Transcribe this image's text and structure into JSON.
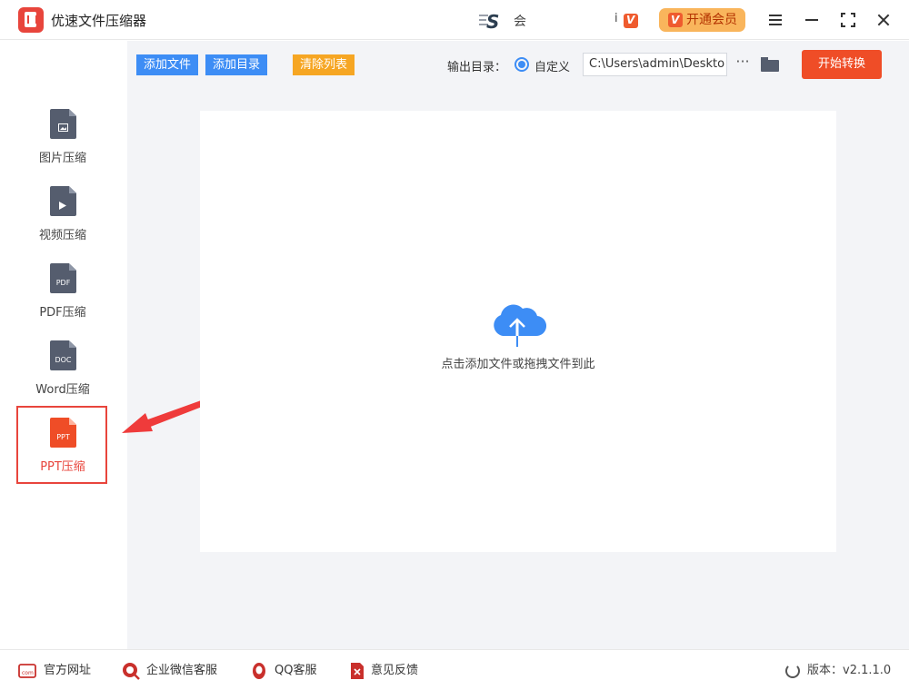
{
  "app": {
    "title": "优速文件压缩器",
    "notice_text": "会",
    "vip_mini_text": "i",
    "vip_button": "开通会员",
    "colors": {
      "accent": "#3d8df5",
      "brand_red": "#ef4d27",
      "warning": "#f6a623",
      "vip": "#f9b55c"
    }
  },
  "sidebar": {
    "items": [
      {
        "label": "图片压缩",
        "icon": "image-file-icon",
        "tag": ""
      },
      {
        "label": "视频压缩",
        "icon": "video-file-icon",
        "tag": ""
      },
      {
        "label": "PDF压缩",
        "icon": "pdf-file-icon",
        "tag": "PDF"
      },
      {
        "label": "Word压缩",
        "icon": "doc-file-icon",
        "tag": "DOC"
      },
      {
        "label": "PPT压缩",
        "icon": "ppt-file-icon",
        "tag": "PPT",
        "active": true
      }
    ]
  },
  "toolbar": {
    "add_file": "添加文件",
    "add_dir": "添加目录",
    "clear_list": "清除列表",
    "output_label": "输出目录：",
    "custom_label": "自定义",
    "output_path": "C:\\Users\\admin\\Deskto",
    "more": "···",
    "start": "开始转换"
  },
  "dropzone": {
    "text": "点击添加文件或拖拽文件到此"
  },
  "footer": {
    "website": "官方网址",
    "wechat": "企业微信客服",
    "qq": "QQ客服",
    "feedback": "意见反馈",
    "version": "版本：v2.1.1.0"
  }
}
